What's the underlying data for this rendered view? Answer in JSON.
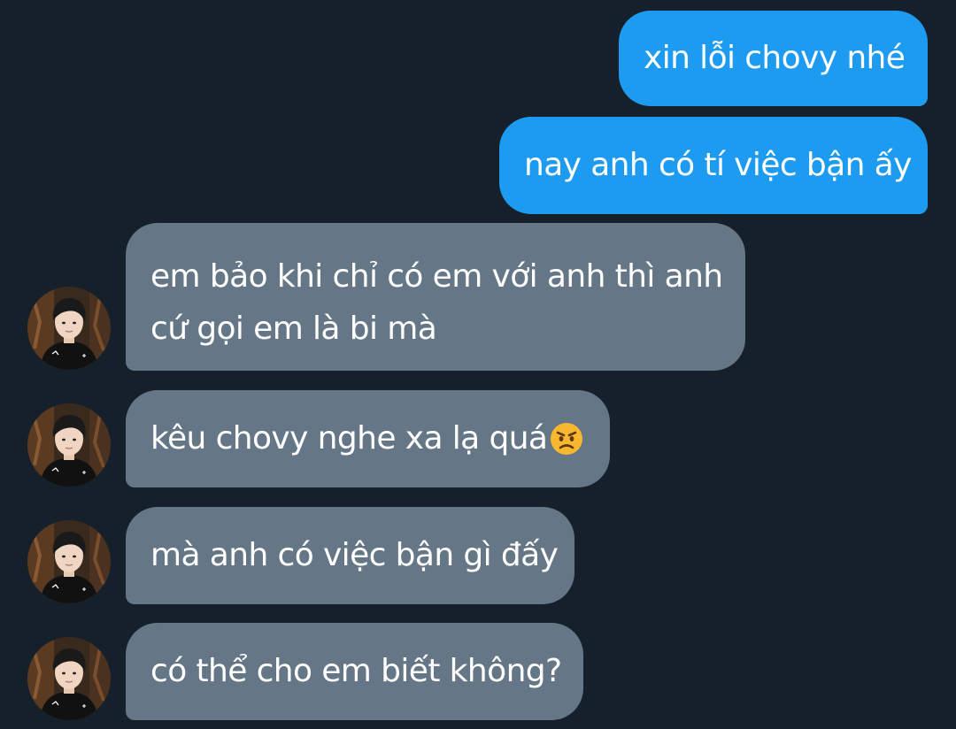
{
  "conversation": {
    "messages": [
      {
        "direction": "outgoing",
        "text": "xin lỗi chovy nhé"
      },
      {
        "direction": "outgoing",
        "text": "nay anh có tí việc bận ấy"
      },
      {
        "direction": "incoming",
        "text": "em bảo khi chỉ có em với anh thì anh cứ gọi em là bi mà"
      },
      {
        "direction": "incoming",
        "text": "kêu chovy nghe xa lạ quá",
        "emoji": "angry-face-emoji"
      },
      {
        "direction": "incoming",
        "text": "mà anh có việc bận gì đấy"
      },
      {
        "direction": "incoming",
        "text": "có thể cho em biết không?"
      }
    ]
  },
  "colors": {
    "background": "#15202b",
    "outgoing_bubble": "#1d9bf0",
    "incoming_bubble": "#657786",
    "text": "#ffffff"
  }
}
